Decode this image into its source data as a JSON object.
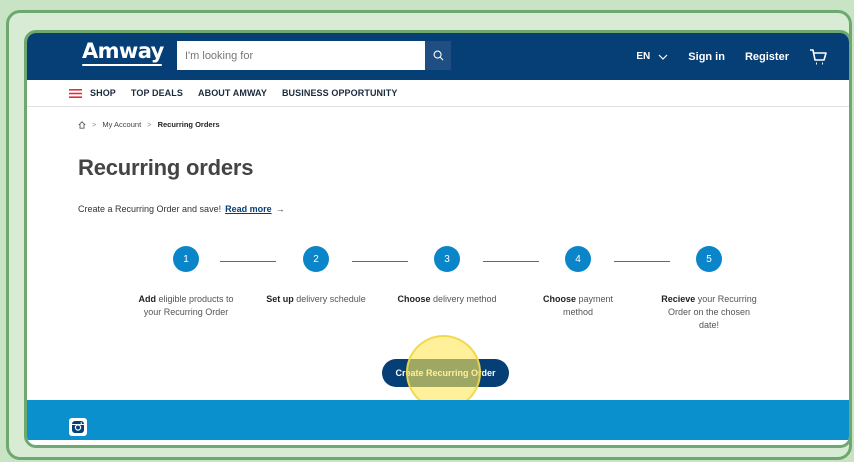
{
  "header": {
    "logo": "Amway",
    "search_placeholder": "I'm looking for",
    "lang": "EN",
    "sign_in": "Sign in",
    "register": "Register"
  },
  "nav": {
    "items": [
      "SHOP",
      "TOP DEALS",
      "ABOUT AMWAY",
      "BUSINESS OPPORTUNITY"
    ]
  },
  "breadcrumb": {
    "items": [
      "My Account",
      "Recurring Orders"
    ]
  },
  "page": {
    "title": "Recurring orders",
    "intro": "Create a Recurring Order and save!",
    "read_more": "Read more",
    "read_more_arrow": "→"
  },
  "steps": [
    {
      "number": "1",
      "bold": "Add",
      "rest": "eligible products to your Recurring Order"
    },
    {
      "number": "2",
      "bold": "Set up",
      "rest": "delivery schedule"
    },
    {
      "number": "3",
      "bold": "Choose",
      "rest": "delivery method"
    },
    {
      "number": "4",
      "bold": "Choose",
      "rest": "payment method"
    },
    {
      "number": "5",
      "bold": "Recieve",
      "rest": "your Recurring Order on the chosen date!"
    }
  ],
  "cta": {
    "label": "Create Recurring Order"
  },
  "colors": {
    "header_bg": "#053f75",
    "accent": "#0a85c9",
    "footer_bg": "#0a90cc",
    "highlight": "#ffe65a"
  }
}
